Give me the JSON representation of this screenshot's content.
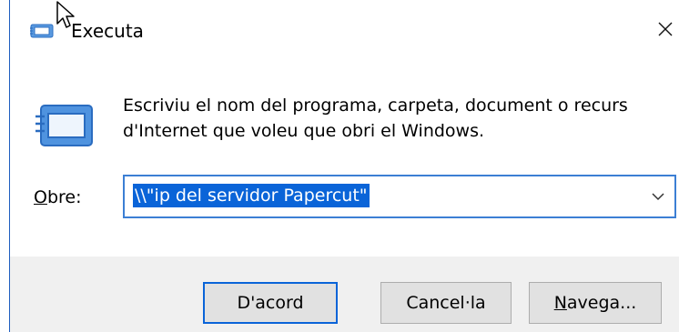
{
  "window": {
    "title": "Executa"
  },
  "dialog": {
    "description_line1": "Escriviu el nom del programa, carpeta, document o recurs",
    "description_line2": "d'Internet que voleu que obri el Windows.",
    "open_label_accel": "O",
    "open_label_rest": "bre:",
    "open_value": "\\\\\"ip del servidor Papercut\""
  },
  "buttons": {
    "ok_label": "D'acord",
    "cancel_label": "Cancel·la",
    "browse_accel": "N",
    "browse_rest": "avega..."
  },
  "icons": {
    "app": "run-icon",
    "close": "close-icon",
    "dropdown": "chevron-down-icon",
    "cursor": "mouse-cursor-icon"
  },
  "colors": {
    "selection": "#0a64d8",
    "focus_border": "#3c7fd4",
    "footer_bg": "#f0f0f0",
    "button_bg": "#e1e1e1",
    "window_border": "#1e5dbf"
  }
}
